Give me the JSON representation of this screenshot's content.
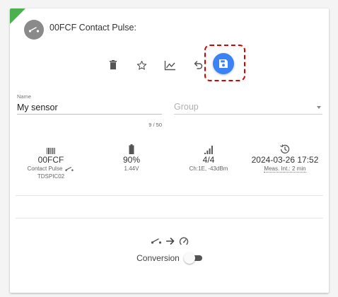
{
  "device": {
    "title": "00FCF Contact Pulse:",
    "status_color": "#4caf50",
    "avatar_icon": "contact-switch-icon"
  },
  "toolbar": {
    "icons": [
      "trash-icon",
      "star-icon",
      "chart-line-icon",
      "undo-icon",
      "save-icon"
    ],
    "accent": "#3b82f6",
    "highlight_color": "#d50000"
  },
  "form": {
    "name_label": "Name",
    "name_value": "My sensor",
    "name_counter": "9 / 50",
    "group_placeholder": "Group"
  },
  "stats": {
    "id": {
      "icon": "barcode-icon",
      "value": "00FCF",
      "type": "Contact Pulse",
      "model": "TDSPIC02"
    },
    "battery": {
      "icon": "battery-icon",
      "percent": "90%",
      "voltage": "1.44V"
    },
    "signal": {
      "icon": "signal-icon",
      "value": "4/4",
      "detail": "Ch:1E, -43dBm"
    },
    "history": {
      "icon": "history-icon",
      "timestamp": "2024-03-26 17:52",
      "interval": "Meas. Int.: 2 min"
    }
  },
  "conversion": {
    "icons": [
      "contact-switch-icon",
      "arrow-right-icon",
      "gauge-icon"
    ],
    "label": "Conversion",
    "enabled": false
  }
}
